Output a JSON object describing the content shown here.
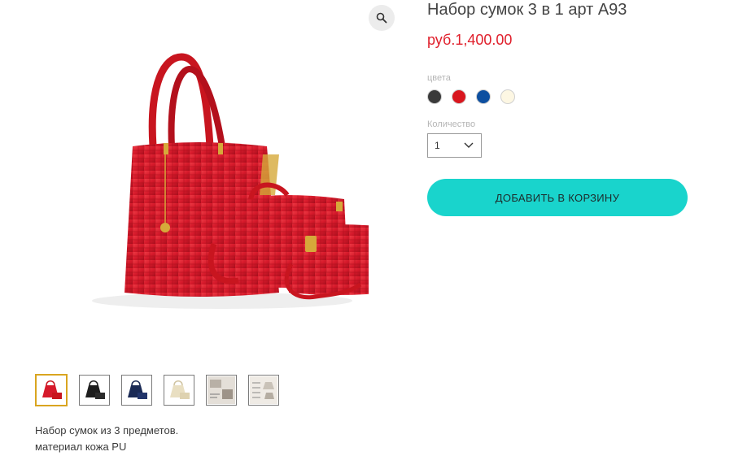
{
  "product": {
    "title": "Набор сумок 3 в 1 арт A93",
    "price": "руб.1,400.00",
    "colors_label": "цвета",
    "colors": [
      {
        "name": "black",
        "hex": "#3a3a3a"
      },
      {
        "name": "red",
        "hex": "#d9161e"
      },
      {
        "name": "blue",
        "hex": "#0d4fa0"
      },
      {
        "name": "cream",
        "hex": "#fdf7e3"
      }
    ],
    "quantity_label": "Количество",
    "quantity_value": "1",
    "add_to_cart_label": "ДОБАВИТЬ В КОРЗИНУ",
    "description": [
      "Набор сумок из 3 предметов.",
      "материал кожа PU"
    ]
  },
  "gallery": {
    "zoom_icon": "search-icon",
    "main_image_color": "#d61a2b",
    "thumbnails": [
      {
        "name": "red-set",
        "color": "#d61a2b",
        "active": true
      },
      {
        "name": "black-set",
        "color": "#1e1e1e",
        "active": false
      },
      {
        "name": "navy-set",
        "color": "#1a2a55",
        "active": false
      },
      {
        "name": "cream-set",
        "color": "#e9dfc2",
        "active": false
      },
      {
        "name": "detail-photo",
        "color": "#b8b0a6",
        "active": false
      },
      {
        "name": "size-chart",
        "color": "#c9c2b8",
        "active": false
      }
    ]
  }
}
